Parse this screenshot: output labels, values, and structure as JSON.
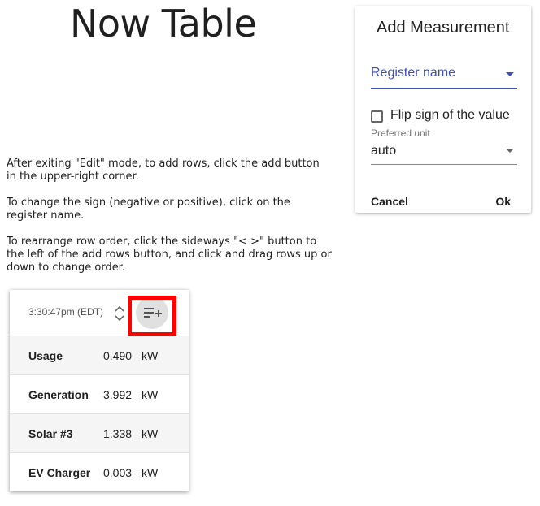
{
  "page": {
    "title": "Now Table",
    "help": [
      "After exiting \"Edit\" mode, to add rows, click the add button in the upper-right corner.",
      "To change the sign (negative or positive), click on the register name.",
      "To rearrange row order, click the sideways \"< >\" button to the left of the add rows button, and click and drag rows up or down to change order."
    ]
  },
  "dialog": {
    "title": "Add Measurement",
    "register_placeholder": "Register name",
    "flip_label": "Flip sign of the value",
    "flip_checked": false,
    "unit_label": "Preferred unit",
    "unit_value": "auto",
    "cancel_label": "Cancel",
    "ok_label": "Ok",
    "accent_color": "#3f51b5"
  },
  "table": {
    "time": "3:30:47pm (EDT)",
    "sort_icon": "unfold-icon",
    "add_icon": "playlist-add-icon",
    "highlight_color": "#ff0000",
    "rows": [
      {
        "label": "Usage",
        "value": "0.490",
        "unit": "kW"
      },
      {
        "label": "Generation",
        "value": "3.992",
        "unit": "kW"
      },
      {
        "label": "Solar #3",
        "value": "1.338",
        "unit": "kW"
      },
      {
        "label": "EV Charger",
        "value": "0.003",
        "unit": "kW"
      }
    ]
  }
}
